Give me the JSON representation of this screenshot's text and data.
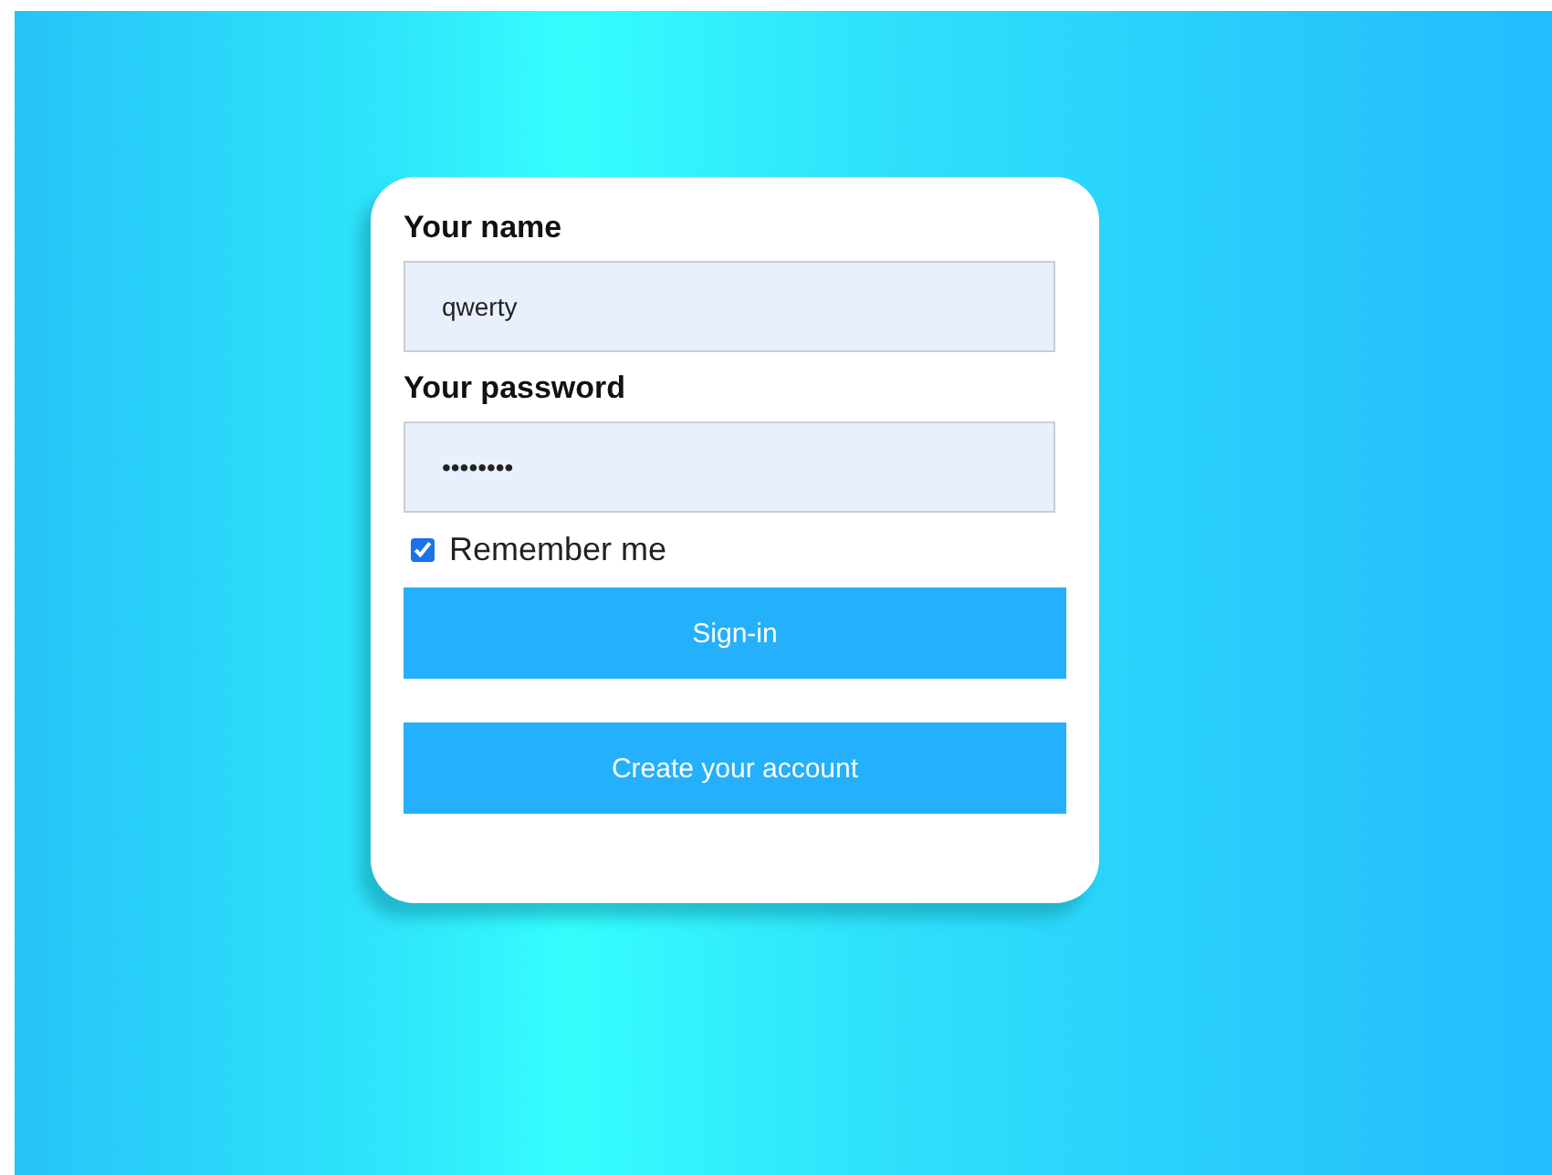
{
  "form": {
    "fields": [
      {
        "label": "Your name",
        "value": "qwerty"
      },
      {
        "label": "Your password",
        "value": "••••••••"
      }
    ],
    "remember": {
      "label": "Remember me",
      "checked": true
    },
    "buttons": [
      "Sign-in",
      "Create your account"
    ]
  }
}
